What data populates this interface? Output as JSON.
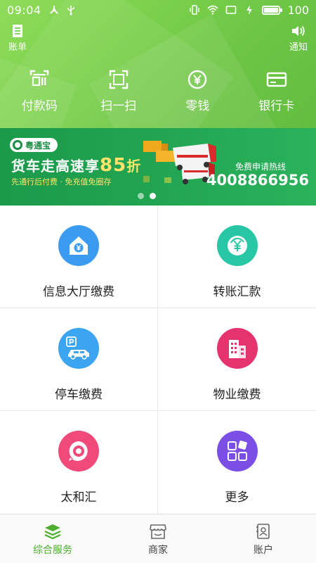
{
  "status_bar": {
    "time": "09:04",
    "battery": "100",
    "battery_level": 1.0
  },
  "header": {
    "bill_label": "账单",
    "notice_label": "通知",
    "quick_actions": [
      {
        "icon": "barcode-icon",
        "label": "付款码"
      },
      {
        "icon": "scan-icon",
        "label": "扫一扫"
      },
      {
        "icon": "yuan-coin-icon",
        "label": "零钱"
      },
      {
        "icon": "bank-card-icon",
        "label": "银行卡"
      }
    ]
  },
  "banner": {
    "brand": "粤通宝",
    "headline_prefix": "货车走高速享",
    "headline_number": "85",
    "headline_suffix": "折",
    "subline": "先通行后付费 · 免充值免圈存",
    "hotline_label": "免费申请热线",
    "hotline": "4008866956",
    "page_count": 2,
    "active_page": 1
  },
  "services": [
    {
      "icon": "house-yuan-icon",
      "label": "信息大厅缴费",
      "color": "#3a9bf0"
    },
    {
      "icon": "transfer-yuan-icon",
      "label": "转账汇款",
      "color": "#27c7a6"
    },
    {
      "icon": "parking-car-icon",
      "label": "停车缴费",
      "color": "#3ba5f2"
    },
    {
      "icon": "building-icon",
      "label": "物业缴费",
      "color": "#e5336e"
    },
    {
      "icon": "target-icon",
      "label": "太和汇",
      "color": "#f04a7a"
    },
    {
      "icon": "more-grid-icon",
      "label": "更多",
      "color": "#7b4ee6"
    }
  ],
  "tabs": [
    {
      "icon": "layers-icon",
      "label": "综合服务",
      "active": true
    },
    {
      "icon": "store-icon",
      "label": "商家",
      "active": false
    },
    {
      "icon": "account-book-icon",
      "label": "账户",
      "active": false
    }
  ],
  "colors": {
    "header_green": "#7bd14c",
    "banner_green": "#22a652",
    "highlight_yellow": "#ffe36a",
    "tab_active": "#4cae2c"
  }
}
